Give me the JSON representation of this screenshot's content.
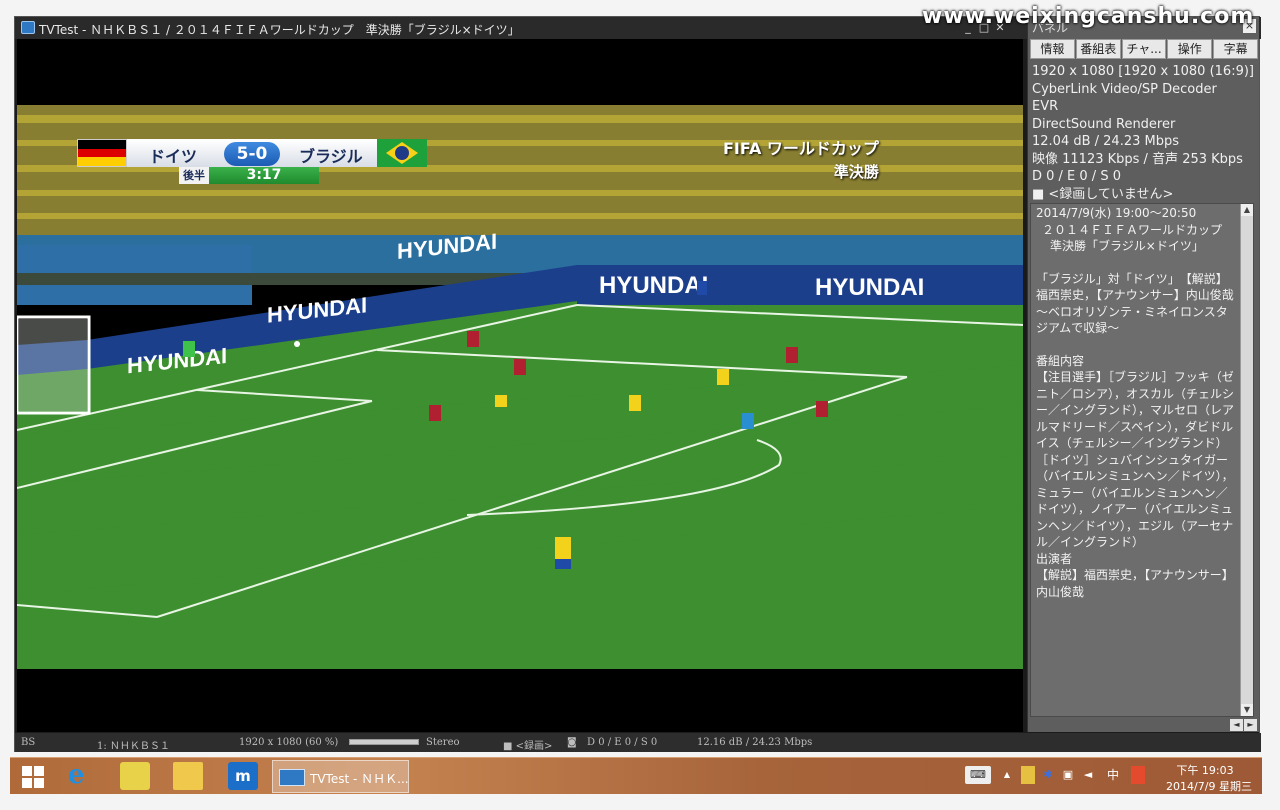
{
  "watermark": "www.weixingcanshu.com",
  "window": {
    "title": "TVTest - ＮＨＫＢＳ１ / ２０１４ＦＩＦＡワールドカップ　準決勝「ブラジル×ドイツ」",
    "minimize": "_",
    "maximize": "□",
    "close": "✕"
  },
  "video": {
    "score": {
      "team1": "ドイツ",
      "score": "5-0",
      "team2": "ブラジル",
      "half": "後半",
      "clock": "3:17"
    },
    "broadcast_logo": {
      "line1": "FIFA ワールドカップ",
      "line2": "準決勝"
    },
    "ad_board_text": "HYUNDAI"
  },
  "panel": {
    "title": "パネル",
    "close": "×",
    "tabs": [
      "情報",
      "番組表",
      "チャ...",
      "操作",
      "字幕"
    ],
    "info": [
      "1920 x 1080 [1920 x 1080 (16:9)]",
      "CyberLink Video/SP Decoder",
      "EVR",
      "DirectSound Renderer",
      "12.04 dB / 24.23 Mbps",
      "映像 11123 Kbps / 音声 253 Kbps",
      "D 0 / E 0 / S 0",
      "■ <録画していません>"
    ],
    "epg": {
      "time": "2014/7/9(水) 19:00～20:50",
      "title1": "２０１４ＦＩＦＡワールドカップ",
      "title2": "準決勝「ブラジル×ドイツ」",
      "desc": "「ブラジル」対「ドイツ」　【解説】福西崇史，【アナウンサー】内山俊哉　～ベロオリゾンテ・ミネイロンスタジアムで収録～",
      "section_heading": "番組内容",
      "content": "【注目選手】［ブラジル］フッキ（ゼニト／ロシア），オスカル（チェルシー／イングランド），マルセロ（レアルマドリード／スペイン），ダビドルイス（チェルシー／イングランド）　［ドイツ］シュバインシュタイガー（バイエルンミュンヘン／ドイツ），ミュラー（バイエルンミュンヘン／ドイツ），ノイアー（バイエルンミュンヘン／ドイツ），エジル（アーセナル／イングランド）",
      "cast_heading": "出演者",
      "cast": "【解説】福西崇史，【アナウンサー】内山俊哉"
    },
    "nav_prev": "◄",
    "nav_next": "►"
  },
  "statusbar": {
    "tuner": "BS",
    "channel": "1: ＮＨＫＢＳ１",
    "resolution": "1920 x 1080 (60 %)",
    "volume_level": 1.0,
    "audio": "Stereo",
    "record": "■ <録画>",
    "errors": "D 0 / E 0 / S 0",
    "signal": "12.16 dB / 24.23 Mbps"
  },
  "taskbar": {
    "active_app": "TVTest - ＮＨＫ...",
    "tray": {
      "up_arrow": "▲",
      "ime": "中",
      "time": "下午 19:03",
      "date": "2014/7/9 星期三"
    }
  }
}
